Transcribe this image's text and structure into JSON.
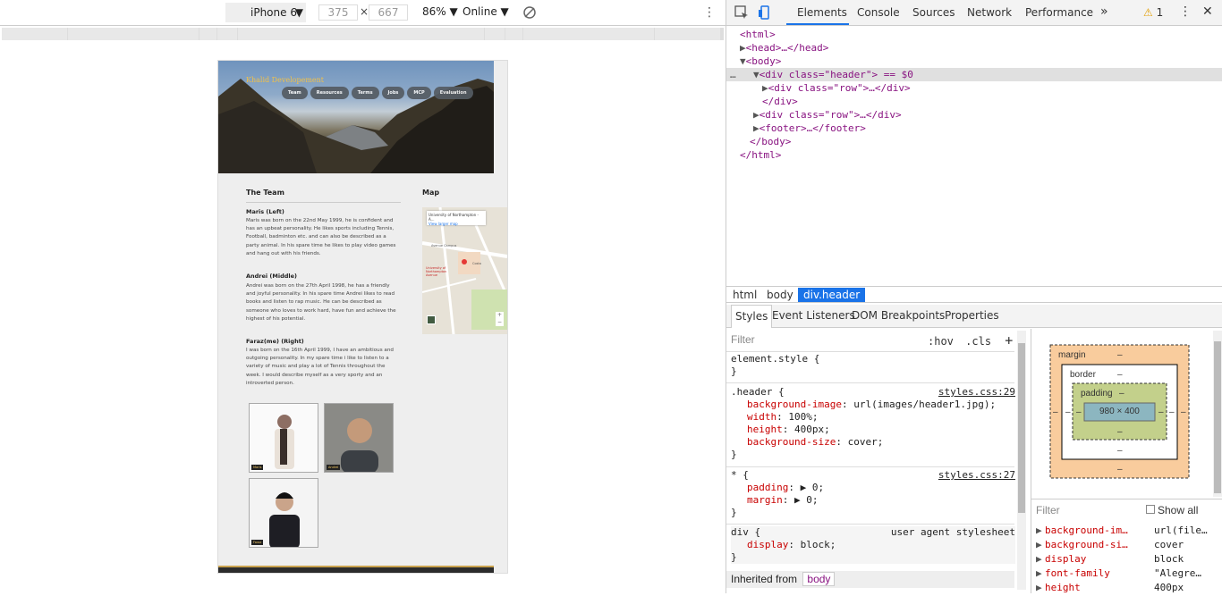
{
  "device_toolbar": {
    "device": "iPhone 6",
    "width": "375",
    "height": "667",
    "dim_separator": "×",
    "zoom": "86%",
    "throttle": "Online"
  },
  "site": {
    "brand": "Khalid Developement",
    "nav": [
      "Team",
      "Resources",
      "Terms",
      "Jobs",
      "MCP",
      "Evaluation"
    ],
    "team_title": "The Team",
    "map_title": "Map",
    "members": [
      {
        "name": "Maris (Left)",
        "bio": "Maris was born on the 22nd May 1999, he is confident and has an upbeat personality. He likes sports including Tennis, Football, badminton etc. and can also be described as a party animal. In his spare time he likes to play video games and hang out with his friends."
      },
      {
        "name": "Andrei (Middle)",
        "bio": "Andrei was born on the 27th April 1998, he has a friendly and joyful personality. In his spare time Andrei likes to read books and listen to rap music. He can be described as someone who loves to work hard, have fun and achieve the highest of his potential."
      },
      {
        "name": "Faraz(me) (Right)",
        "bio": "I was born on the 16th April 1999, I have an ambitious and outgoing personality. In my spare time i like to listen to a variety of music and play a lot of Tennis throughout the week. I would describe myself as a very sporty and an introverted person."
      }
    ],
    "photo_tags": [
      "Maris",
      "Andrei",
      "Faraz"
    ],
    "map_box_title": "University of Northampton - A...",
    "map_box_link": "View larger map",
    "map_labels": [
      "Avenue Campus",
      "University of Northampton Avenue",
      "Costa"
    ]
  },
  "devtools": {
    "tabs": [
      "Elements",
      "Console",
      "Sources",
      "Network",
      "Performance"
    ],
    "more": "»",
    "warnings": "1",
    "dom": [
      {
        "indent": 0,
        "arrow": "",
        "text": "<html>"
      },
      {
        "indent": 1,
        "arrow": "▶",
        "text": "<head>…</head>"
      },
      {
        "indent": 1,
        "arrow": "▼",
        "text": "<body>"
      },
      {
        "indent": 2,
        "arrow": "▼",
        "text": "<div class=\"header\"> == $0"
      },
      {
        "indent": 3,
        "arrow": "▶",
        "text": "<div class=\"row\">…</div>"
      },
      {
        "indent": 2,
        "arrow": "",
        "text": "</div>"
      },
      {
        "indent": 2,
        "arrow": "▶",
        "text": "<div class=\"row\">…</div>"
      },
      {
        "indent": 2,
        "arrow": "▶",
        "text": "<footer>…</footer>"
      },
      {
        "indent": 1,
        "arrow": "",
        "text": "</body>"
      },
      {
        "indent": 0,
        "arrow": "",
        "text": "</html>"
      }
    ],
    "crumbs": [
      "html",
      "body",
      "div.header"
    ],
    "subtabs": [
      "Styles",
      "Event Listeners",
      "DOM Breakpoints",
      "Properties"
    ],
    "filter_placeholder": "Filter",
    "hov": ":hov",
    "cls": ".cls",
    "plus": "+",
    "element_style": "element.style {",
    "close_brace": "}",
    "rule1": {
      "selector": ".header {",
      "source": "styles.css:29",
      "props": [
        [
          "background-image",
          "url(images/header1.jpg);"
        ],
        [
          "width",
          "100%;"
        ],
        [
          "height",
          "400px;"
        ],
        [
          "background-size",
          "cover;"
        ]
      ]
    },
    "rule2": {
      "selector": "* {",
      "source": "styles.css:27",
      "props": [
        [
          "padding",
          "▶ 0;"
        ],
        [
          "margin",
          "▶ 0;"
        ]
      ]
    },
    "rule3": {
      "selector": "div {",
      "source": "user agent stylesheet",
      "props": [
        [
          "display",
          "block;"
        ]
      ]
    },
    "inherited": "Inherited from",
    "inherited_tag": "body",
    "boxmodel": {
      "margin": "margin",
      "border": "border",
      "padding": "padding",
      "content": "980 × 400",
      "dash": "–"
    },
    "computed_filter": "Filter",
    "show_all": "Show all",
    "computed": [
      [
        "background-im…",
        "url(file…"
      ],
      [
        "background-si…",
        "cover"
      ],
      [
        "display",
        "block"
      ],
      [
        "font-family",
        "\"Alegre…"
      ],
      [
        "height",
        "400px"
      ]
    ]
  }
}
